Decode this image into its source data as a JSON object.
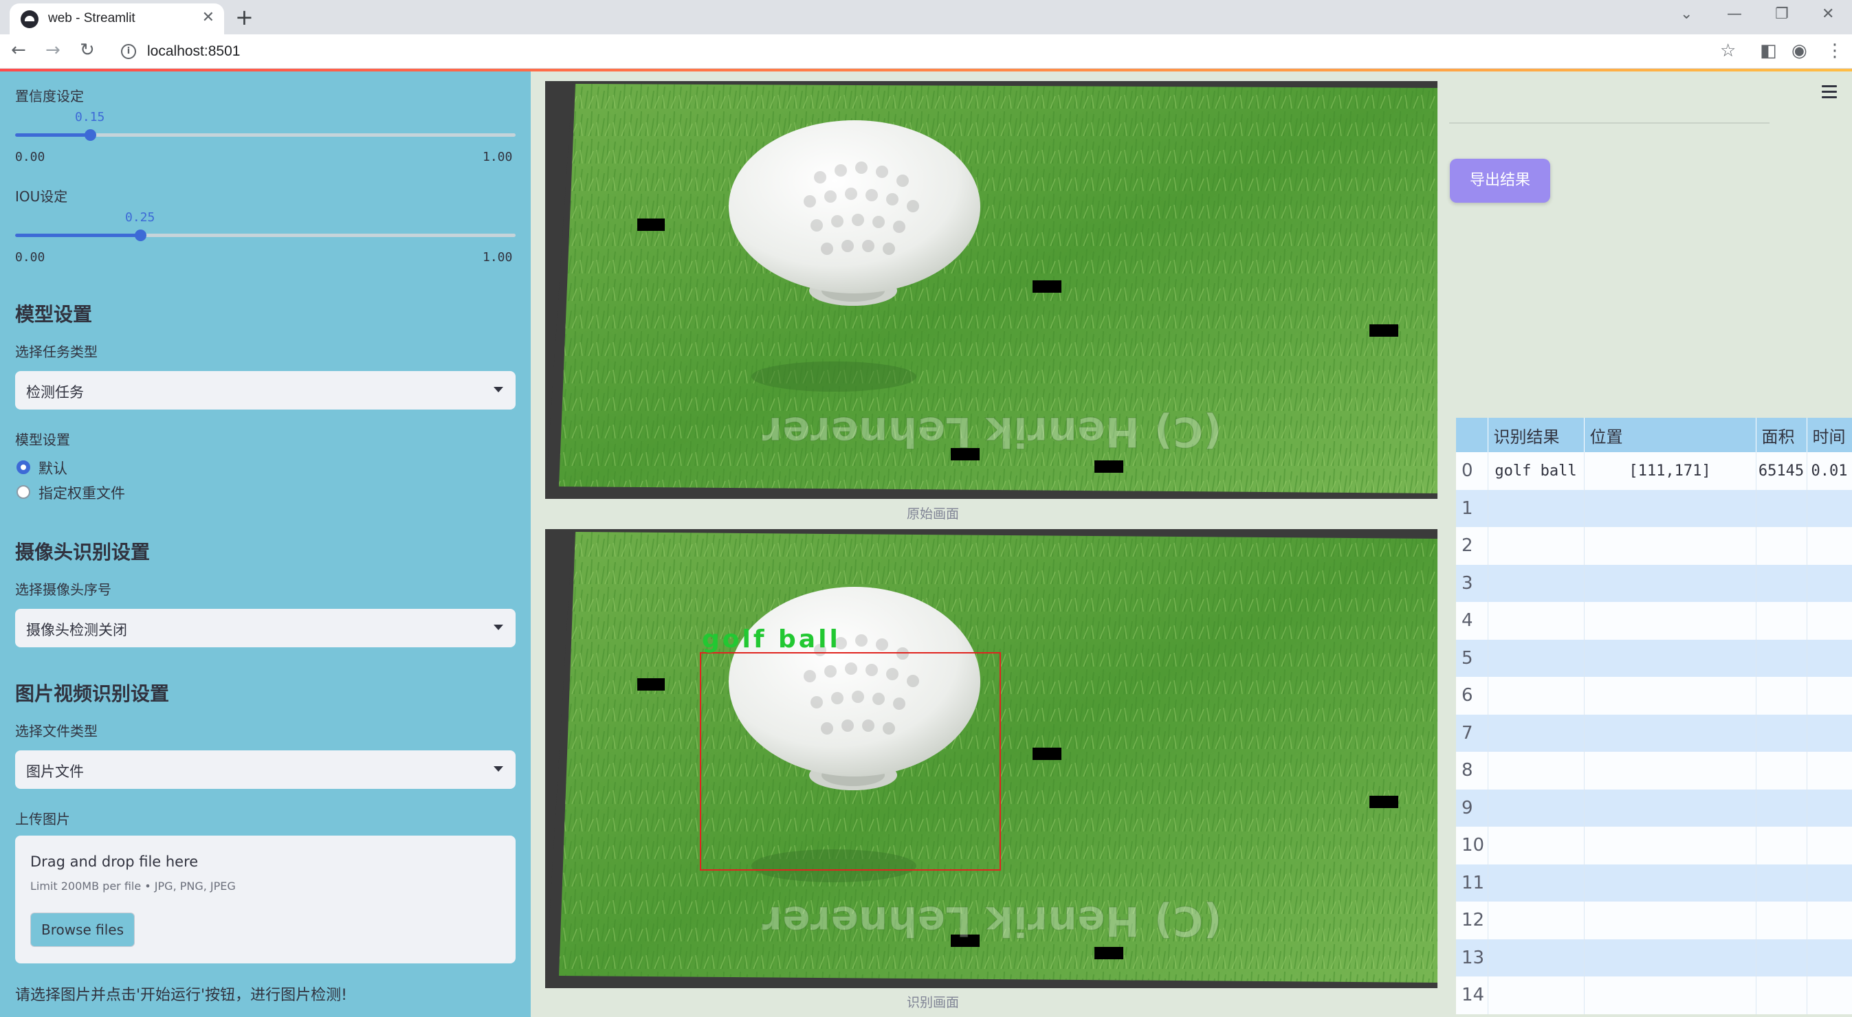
{
  "browser": {
    "tab_title": "web - Streamlit",
    "url": "localhost:8501"
  },
  "sidebar": {
    "confidence": {
      "label": "置信度设定",
      "value": "0.15",
      "min": "0.00",
      "max": "1.00",
      "fraction": 0.15
    },
    "iou": {
      "label": "IOU设定",
      "value": "0.25",
      "min": "0.00",
      "max": "1.00",
      "fraction": 0.25
    },
    "model_section": {
      "heading": "模型设置",
      "task_label": "选择任务类型",
      "task_value": "检测任务",
      "weights_label": "模型设置",
      "options": [
        "默认",
        "指定权重文件"
      ],
      "selected_index": 0
    },
    "camera_section": {
      "heading": "摄像头识别设置",
      "camera_label": "选择摄像头序号",
      "camera_value": "摄像头检测关闭"
    },
    "media_section": {
      "heading": "图片视频识别设置",
      "file_type_label": "选择文件类型",
      "file_type_value": "图片文件",
      "upload_label": "上传图片",
      "dropzone_title": "Drag and drop file here",
      "dropzone_limit": "Limit 200MB per file • JPG, PNG, JPEG",
      "browse_label": "Browse files"
    },
    "hint": "请选择图片并点击'开始运行'按钮，进行图片检测!"
  },
  "main": {
    "original_caption": "原始画面",
    "result_caption": "识别画面",
    "watermark": "(C) Henrik Lehnerer",
    "detection_label": "golf ball"
  },
  "right_panel": {
    "export_label": "导出结果",
    "table": {
      "headers": [
        "",
        "识别结果",
        "位置",
        "面积",
        "时间"
      ],
      "rows": [
        [
          "0",
          "golf ball",
          "[111,171]",
          "65145",
          "0.01"
        ],
        [
          "1",
          "",
          "",
          "",
          ""
        ],
        [
          "2",
          "",
          "",
          "",
          ""
        ],
        [
          "3",
          "",
          "",
          "",
          ""
        ],
        [
          "4",
          "",
          "",
          "",
          ""
        ],
        [
          "5",
          "",
          "",
          "",
          ""
        ],
        [
          "6",
          "",
          "",
          "",
          ""
        ],
        [
          "7",
          "",
          "",
          "",
          ""
        ],
        [
          "8",
          "",
          "",
          "",
          ""
        ],
        [
          "9",
          "",
          "",
          "",
          ""
        ],
        [
          "10",
          "",
          "",
          "",
          ""
        ],
        [
          "11",
          "",
          "",
          "",
          ""
        ],
        [
          "12",
          "",
          "",
          "",
          ""
        ],
        [
          "13",
          "",
          "",
          "",
          ""
        ],
        [
          "14",
          "",
          "",
          "",
          ""
        ]
      ]
    }
  },
  "colors": {
    "sidebar_bg": "#79c4d9",
    "slider_accent": "#3d6ad6",
    "export_button": "#9b8cf0",
    "detection_box": "#e0241f",
    "detection_text": "#22c832"
  }
}
